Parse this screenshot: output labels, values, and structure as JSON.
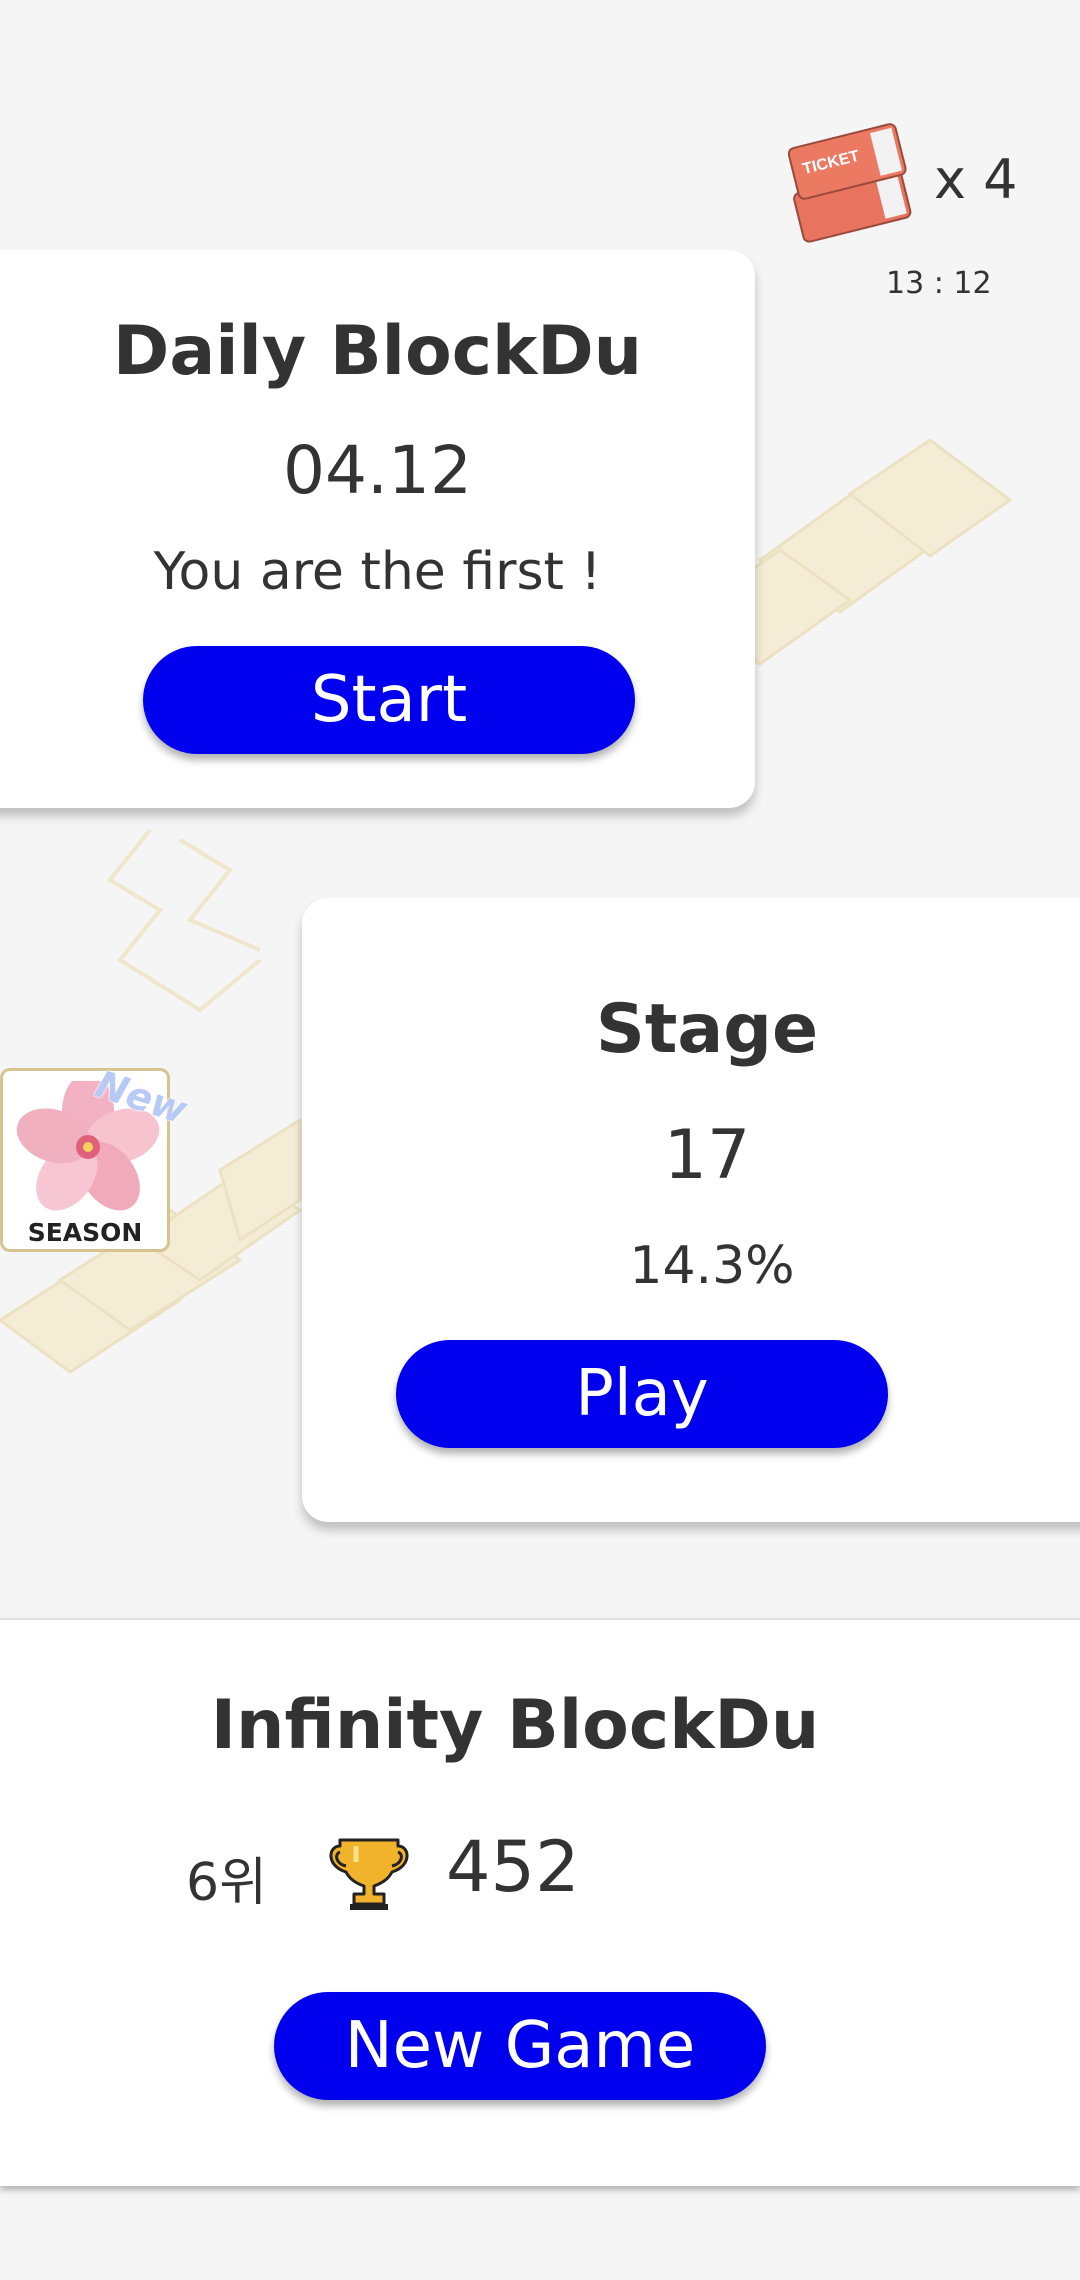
{
  "tickets": {
    "icon": "ticket-icon",
    "icon_text": "TICKET",
    "count": "x 4",
    "timer": "13 : 12"
  },
  "daily": {
    "title": "Daily BlockDu",
    "date": "04.12",
    "status": "You are the first !",
    "button_label": "Start"
  },
  "stage": {
    "title": "Stage",
    "number": "17",
    "progress": "14.3%",
    "button_label": "Play"
  },
  "season": {
    "icon": "flower-icon",
    "label": "SEASON",
    "new_tag": "New"
  },
  "infinity": {
    "title": "Infinity BlockDu",
    "rank": "6위",
    "trophy_icon": "trophy-icon",
    "score": "452",
    "button_label": "New Game"
  },
  "colors": {
    "button": "#0000ee",
    "background": "#f5f5f5",
    "card": "#ffffff",
    "text": "#333333",
    "decor_block": "#f4ecd2"
  }
}
